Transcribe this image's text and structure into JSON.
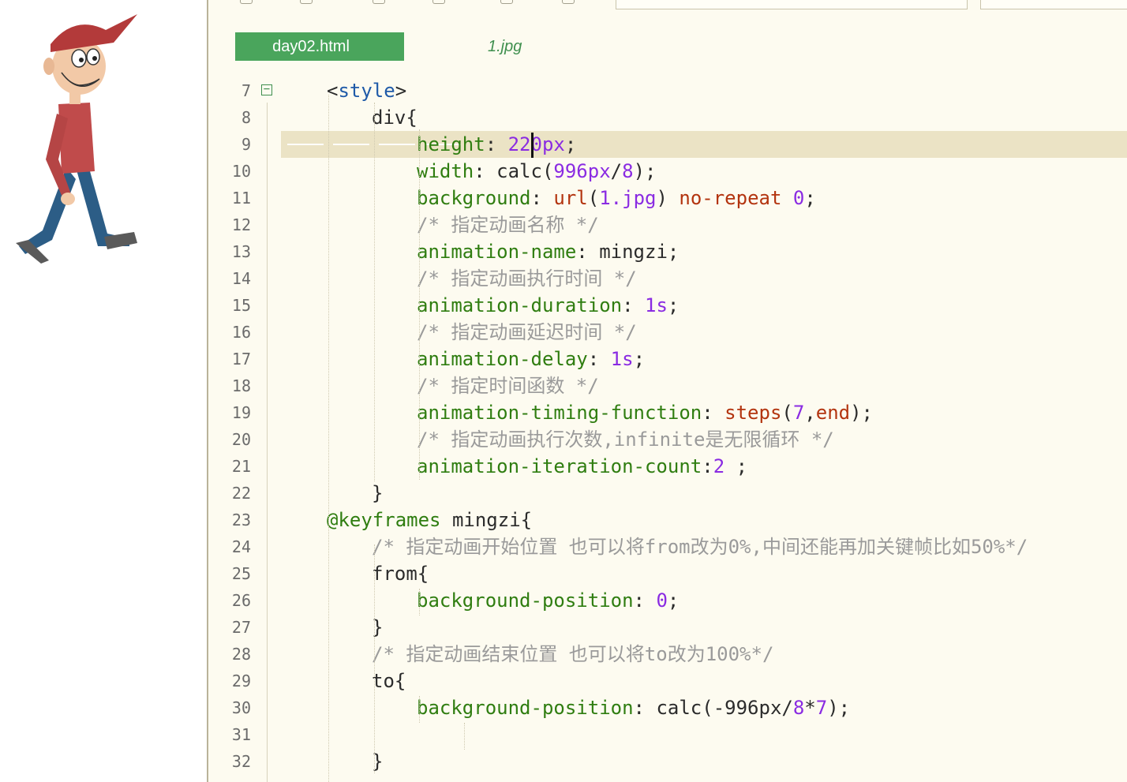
{
  "editor": {
    "tabs": [
      {
        "label": "day02.html",
        "active": true
      },
      {
        "label": "1.jpg",
        "active": false
      }
    ],
    "current_line": 9,
    "lines": [
      {
        "n": "7",
        "indent": 2,
        "tokens": [
          {
            "t": "<",
            "c": "plain"
          },
          {
            "t": "style",
            "c": "tag"
          },
          {
            "t": ">",
            "c": "plain"
          }
        ]
      },
      {
        "n": "8",
        "indent": 3,
        "tokens": [
          {
            "t": "div{",
            "c": "plain"
          }
        ]
      },
      {
        "n": "9",
        "indent": 4,
        "tokens": [
          {
            "t": "height",
            "c": "prop"
          },
          {
            "t": ": ",
            "c": "plain"
          },
          {
            "t": "220px",
            "c": "num"
          },
          {
            "t": ";",
            "c": "plain"
          }
        ]
      },
      {
        "n": "10",
        "indent": 4,
        "tokens": [
          {
            "t": "width",
            "c": "prop"
          },
          {
            "t": ": calc(",
            "c": "plain"
          },
          {
            "t": "996px",
            "c": "num"
          },
          {
            "t": "/",
            "c": "plain"
          },
          {
            "t": "8",
            "c": "num"
          },
          {
            "t": ");",
            "c": "plain"
          }
        ]
      },
      {
        "n": "11",
        "indent": 4,
        "tokens": [
          {
            "t": "background",
            "c": "prop"
          },
          {
            "t": ": ",
            "c": "plain"
          },
          {
            "t": "url",
            "c": "fn"
          },
          {
            "t": "(",
            "c": "plain"
          },
          {
            "t": "1.jpg",
            "c": "num"
          },
          {
            "t": ") ",
            "c": "plain"
          },
          {
            "t": "no-repeat",
            "c": "fn"
          },
          {
            "t": " ",
            "c": "plain"
          },
          {
            "t": "0",
            "c": "num"
          },
          {
            "t": ";",
            "c": "plain"
          }
        ]
      },
      {
        "n": "12",
        "indent": 4,
        "tokens": [
          {
            "t": "/* 指定动画名称 */",
            "c": "cmt"
          }
        ]
      },
      {
        "n": "13",
        "indent": 4,
        "tokens": [
          {
            "t": "animation-name",
            "c": "prop"
          },
          {
            "t": ": mingzi;",
            "c": "plain"
          }
        ]
      },
      {
        "n": "14",
        "indent": 4,
        "tokens": [
          {
            "t": "/* 指定动画执行时间 */",
            "c": "cmt"
          }
        ]
      },
      {
        "n": "15",
        "indent": 4,
        "tokens": [
          {
            "t": "animation-duration",
            "c": "prop"
          },
          {
            "t": ": ",
            "c": "plain"
          },
          {
            "t": "1s",
            "c": "num"
          },
          {
            "t": ";",
            "c": "plain"
          }
        ]
      },
      {
        "n": "16",
        "indent": 4,
        "tokens": [
          {
            "t": "/* 指定动画延迟时间 */",
            "c": "cmt"
          }
        ]
      },
      {
        "n": "17",
        "indent": 4,
        "tokens": [
          {
            "t": "animation-delay",
            "c": "prop"
          },
          {
            "t": ": ",
            "c": "plain"
          },
          {
            "t": "1s",
            "c": "num"
          },
          {
            "t": ";",
            "c": "plain"
          }
        ]
      },
      {
        "n": "18",
        "indent": 4,
        "tokens": [
          {
            "t": "/* 指定时间函数 */",
            "c": "cmt"
          }
        ]
      },
      {
        "n": "19",
        "indent": 4,
        "tokens": [
          {
            "t": "animation-timing-function",
            "c": "prop"
          },
          {
            "t": ": ",
            "c": "plain"
          },
          {
            "t": "steps",
            "c": "fn"
          },
          {
            "t": "(",
            "c": "plain"
          },
          {
            "t": "7",
            "c": "num"
          },
          {
            "t": ",",
            "c": "plain"
          },
          {
            "t": "end",
            "c": "fn"
          },
          {
            "t": ");",
            "c": "plain"
          }
        ]
      },
      {
        "n": "20",
        "indent": 4,
        "tokens": [
          {
            "t": "/* 指定动画执行次数,infinite是无限循环 */",
            "c": "cmt"
          }
        ]
      },
      {
        "n": "21",
        "indent": 4,
        "tokens": [
          {
            "t": "animation-iteration-count",
            "c": "prop"
          },
          {
            "t": ":",
            "c": "plain"
          },
          {
            "t": "2",
            "c": "num"
          },
          {
            "t": " ;",
            "c": "plain"
          }
        ]
      },
      {
        "n": "22",
        "indent": 3,
        "tokens": [
          {
            "t": "}",
            "c": "plain"
          }
        ]
      },
      {
        "n": "23",
        "indent": 2,
        "tokens": [
          {
            "t": "@keyframes",
            "c": "at"
          },
          {
            "t": " mingzi{",
            "c": "plain"
          }
        ]
      },
      {
        "n": "24",
        "indent": 3,
        "tokens": [
          {
            "t": "/* 指定动画开始位置 也可以将from改为0%,中间还能再加关键帧比如50%*/",
            "c": "cmt"
          }
        ]
      },
      {
        "n": "25",
        "indent": 3,
        "tokens": [
          {
            "t": "from{",
            "c": "plain"
          }
        ]
      },
      {
        "n": "26",
        "indent": 4,
        "tokens": [
          {
            "t": "background-position",
            "c": "prop"
          },
          {
            "t": ": ",
            "c": "plain"
          },
          {
            "t": "0",
            "c": "num"
          },
          {
            "t": ";",
            "c": "plain"
          }
        ]
      },
      {
        "n": "27",
        "indent": 3,
        "tokens": [
          {
            "t": "}",
            "c": "plain"
          }
        ]
      },
      {
        "n": "28",
        "indent": 3,
        "tokens": [
          {
            "t": "/* 指定动画结束位置 也可以将to改为100%*/",
            "c": "cmt"
          }
        ]
      },
      {
        "n": "29",
        "indent": 3,
        "tokens": [
          {
            "t": "to{",
            "c": "plain"
          }
        ]
      },
      {
        "n": "30",
        "indent": 4,
        "tokens": [
          {
            "t": "background-position",
            "c": "prop"
          },
          {
            "t": ": calc(-996px/",
            "c": "plain"
          },
          {
            "t": "8",
            "c": "num"
          },
          {
            "t": "*",
            "c": "plain"
          },
          {
            "t": "7",
            "c": "num"
          },
          {
            "t": ");",
            "c": "plain"
          }
        ]
      },
      {
        "n": "31",
        "indent": 4,
        "tokens": []
      },
      {
        "n": "32",
        "indent": 3,
        "tokens": [
          {
            "t": "}",
            "c": "plain"
          }
        ]
      }
    ]
  }
}
